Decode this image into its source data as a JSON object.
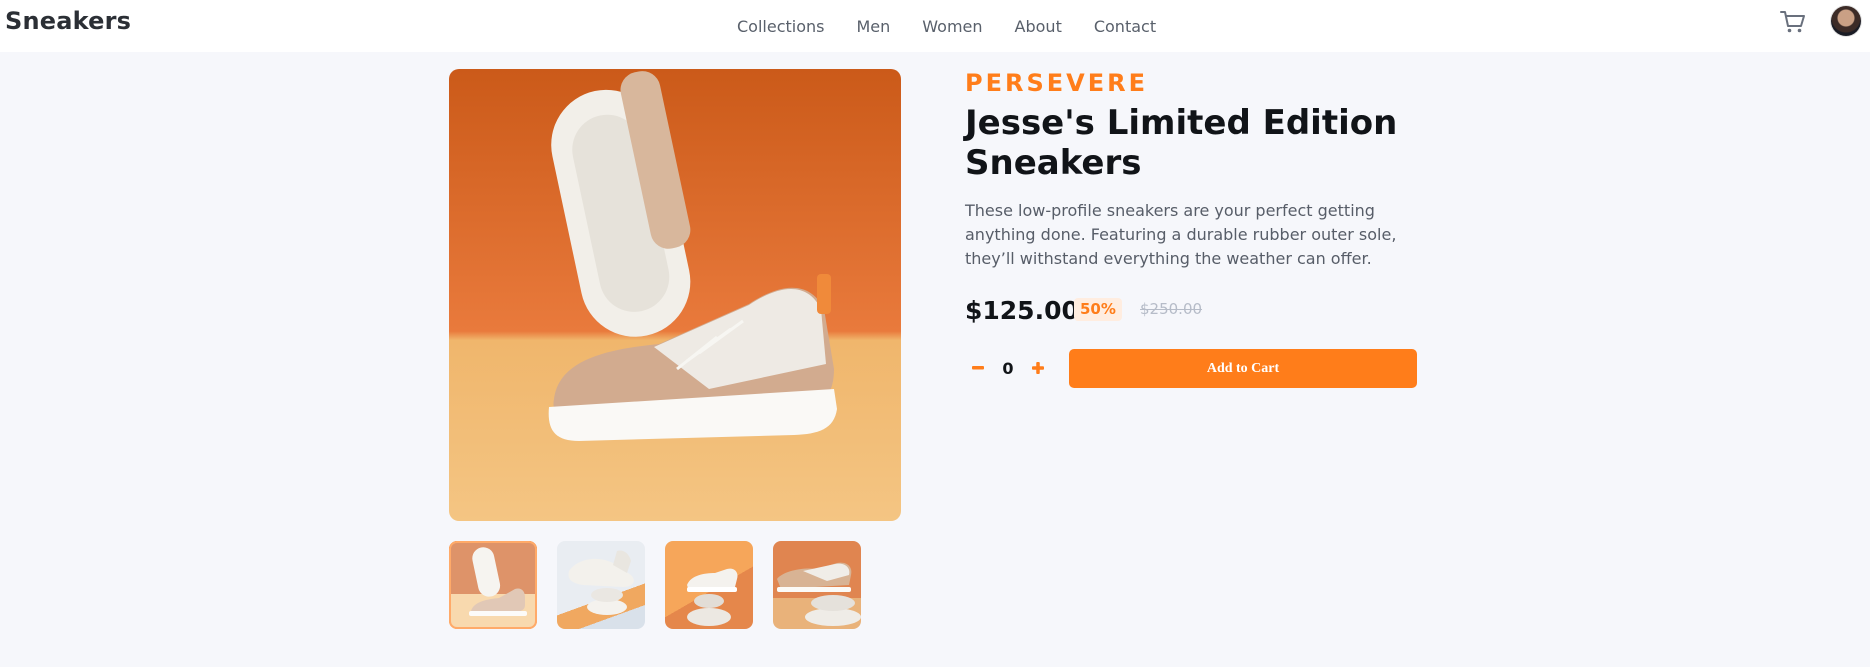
{
  "header": {
    "brand": "Sneakers",
    "nav": [
      "Collections",
      "Men",
      "Women",
      "About",
      "Contact"
    ]
  },
  "product": {
    "company": "PERSEVERE",
    "title": "Jesse's Limited Edition Sneakers",
    "description": "These low-profile sneakers are your perfect getting anything done. Featuring a durable rubber outer sole, they’ll withstand everything the weather can offer.",
    "price": "$125.00",
    "discount": "50%",
    "original_price": "$250.00",
    "quantity": "0",
    "minus": "–",
    "plus": "+",
    "add_to_cart": "Add to Cart"
  },
  "gallery": {
    "selected_index": 0,
    "thumbnails": 4
  },
  "colors": {
    "accent": "#ff7d1a",
    "accent_soft": "#ffede0",
    "text_dark": "#111418",
    "text_muted": "#575d68"
  },
  "icons": [
    "cart-icon",
    "avatar"
  ]
}
